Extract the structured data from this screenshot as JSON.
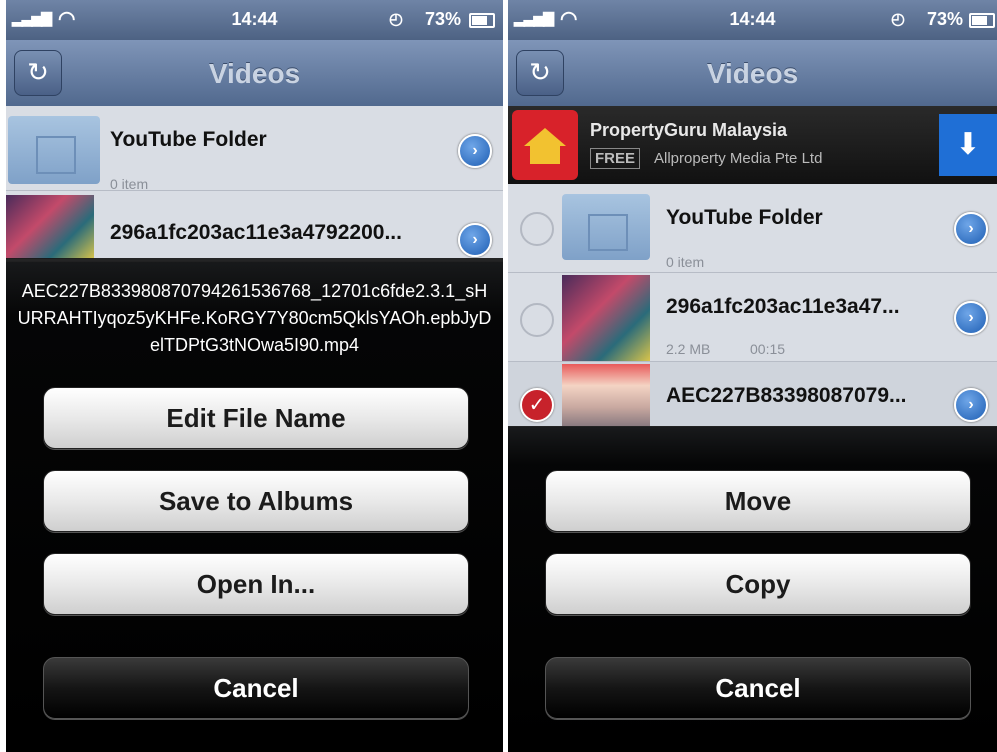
{
  "status": {
    "time": "14:44",
    "battery": "73%"
  },
  "nav": {
    "title": "Videos"
  },
  "left": {
    "rows": [
      {
        "name": "YouTube Folder",
        "sub": "0 item"
      },
      {
        "name": "296a1fc203ac11e3a4792200..."
      }
    ],
    "filename": "AEC227B833980870794261536768_12701c6fde2.3.1_sHURRAHTIyqoz5yKHFe.KoRGY7Y80cm5QklsYAOh.epbJyDelTDPtG3tNOwa5I90.mp4",
    "actions": {
      "edit": "Edit File Name",
      "save": "Save to Albums",
      "open": "Open In...",
      "cancel": "Cancel"
    }
  },
  "right": {
    "ad": {
      "title": "PropertyGuru Malaysia",
      "free": "FREE",
      "publisher": "Allproperty Media Pte Ltd"
    },
    "rows": [
      {
        "name": "YouTube Folder",
        "sub": "0 item"
      },
      {
        "name": "296a1fc203ac11e3a47...",
        "size": "2.2 MB",
        "duration": "00:15"
      },
      {
        "name": "AEC227B83398087079..."
      }
    ],
    "actions": {
      "move": "Move",
      "copy": "Copy",
      "cancel": "Cancel"
    }
  }
}
